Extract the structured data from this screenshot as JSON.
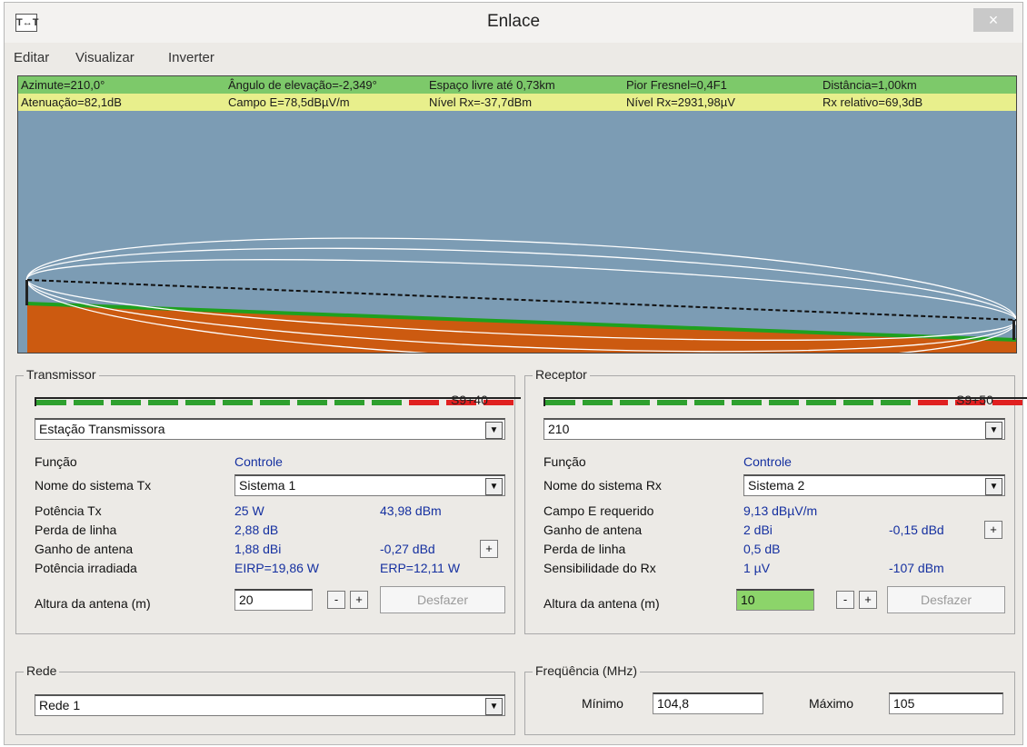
{
  "window": {
    "title": "Enlace",
    "app_icon": "T↔T",
    "close_icon": "×"
  },
  "menu": [
    "Editar",
    "Visualizar",
    "Inverter"
  ],
  "info_bar": {
    "row1": [
      "Azimute=210,0°",
      "Ângulo de elevação=-2,349°",
      "Espaço livre até 0,73km",
      "Pior Fresnel=0,4F1",
      "Distância=1,00km"
    ],
    "row2": [
      "Atenuação=82,1dB",
      "Campo E=78,5dBµV/m",
      "Nível Rx=-37,7dBm",
      "Nível Rx=2931,98µV",
      "Rx relativo=69,3dB"
    ]
  },
  "profile_colors": {
    "sky": "#7c9cb4",
    "terrain": "#cc5a10",
    "ground_line": "#1fa01f",
    "fresnel": "#ffffff",
    "los": "#111111"
  },
  "transmissor": {
    "title": "Transmissor",
    "meter": {
      "green_segments": 10,
      "red_segments": 3,
      "label": "S9+40"
    },
    "station": "Estação Transmissora",
    "rows": [
      {
        "label": "Função",
        "v1": "Controle",
        "v2": ""
      },
      {
        "label": "Nome do sistema Tx",
        "combo": "Sistema  1"
      },
      {
        "label": "Potência Tx",
        "v1": "25 W",
        "v2": "43,98 dBm"
      },
      {
        "label": "Perda de linha",
        "v1": "2,88 dB",
        "v2": ""
      },
      {
        "label": "Ganho de antena",
        "v1": "1,88 dBi",
        "v2": "-0,27 dBd"
      },
      {
        "label": "Potência irradiada",
        "v1": "EIRP=19,86 W",
        "v2": "ERP=12,11 W"
      }
    ],
    "height_label": "Altura da antena (m)",
    "height_value": "20",
    "minus": "-",
    "plus": "+",
    "undo": "Desfazer"
  },
  "receptor": {
    "title": "Receptor",
    "meter": {
      "green_segments": 10,
      "red_segments": 3,
      "label": "S9+50"
    },
    "station": "210",
    "rows": [
      {
        "label": "Função",
        "v1": "Controle",
        "v2": ""
      },
      {
        "label": "Nome do sistema Rx",
        "combo": "Sistema  2"
      },
      {
        "label": "Campo E requerido",
        "v1": "9,13 dBµV/m",
        "v2": ""
      },
      {
        "label": "Ganho de antena",
        "v1": "2 dBi",
        "v2": "-0,15 dBd"
      },
      {
        "label": "Perda de linha",
        "v1": "0,5 dB",
        "v2": ""
      },
      {
        "label": "Sensibilidade do Rx",
        "v1": "1 µV",
        "v2": "-107 dBm"
      }
    ],
    "height_label": "Altura da antena (m)",
    "height_value": "10",
    "minus": "-",
    "plus": "+",
    "undo": "Desfazer"
  },
  "rede": {
    "title": "Rede",
    "value": "Rede 1"
  },
  "frequencia": {
    "title": "Freqüência (MHz)",
    "min_label": "Mínimo",
    "min_value": "104,8",
    "max_label": "Máximo",
    "max_value": "105"
  }
}
